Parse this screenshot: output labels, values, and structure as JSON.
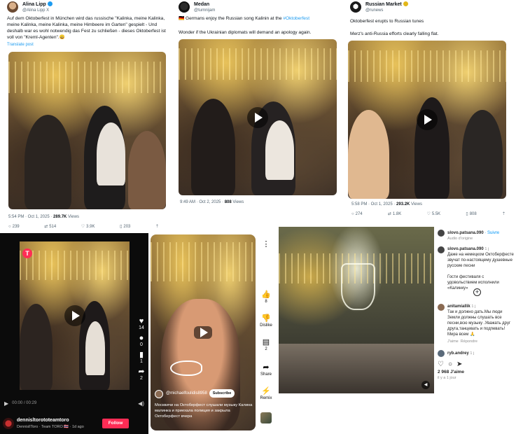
{
  "tweet1": {
    "name": "Alina Lipp",
    "handle": "@Alina Lipp X",
    "text": "Auf dem Oktoberfest in München wird das russische \"Kalinka, meine Kalinka, meine Kalinka, meine Kalinka, meine Himbeere im Garten\" gespielt - Und deshalb war es wohl notwendig das Fest zu schließen - dieses Oktoberfest ist voll von \"Kreml-Agenten\".😀",
    "translate": "Translate post",
    "time": "5:54 PM · Oct 1, 2025 · ",
    "views": "289.7K",
    "views_label": " Views",
    "replies": "239",
    "retweets": "514",
    "likes": "3.9K",
    "bookmarks": "203"
  },
  "tweet2": {
    "name": "Medan",
    "handle": "@tumnijam",
    "text_flag": "🇩🇪",
    "text_a": " Germans enjoy the Russian song Kalinin at the ",
    "hashtag": "#Oktoberfest",
    "text_b": "Wonder if the Ukrainian diplomats will demand an apology again.",
    "time": "9:49 AM · Oct 2, 2025 · ",
    "views": "808",
    "views_label": " Views"
  },
  "tweet3": {
    "name": "Russian Market",
    "handle": "@runews",
    "text_a": "Oktoberfest erupts to Russian tunes",
    "text_b": "Merz's anti-Russia efforts clearly falling flat.",
    "time": "5:58 PM · Oct 1, 2025 · ",
    "views": "293.2K",
    "views_label": " Views",
    "replies": "274",
    "retweets": "1.8K",
    "likes": "5.5K",
    "bookmarks": "808"
  },
  "tiktok": {
    "username": "dennisltorototeamtoro",
    "subline": "DennisllToro · Team TORO 🇹🇭 · 1d ago",
    "follow": "Follow",
    "time": "00:00 / 00:29",
    "likes": "14",
    "comments": "0",
    "bookmarks": "1",
    "shares": "2",
    "logo_letter": "T"
  },
  "shorts": {
    "channel": "@michaelfoulidis8958",
    "subscribe": "Subscribe",
    "caption": "Москвичи на Октоберфест слушали музыку Калина малинка и приехала полиция и закрыла Октоберфест вчера",
    "likes": "8",
    "dislike": "Dislike",
    "comments": "2",
    "share": "Share",
    "remix": "Remix"
  },
  "instagram": {
    "user": "slovo.patsana.090",
    "follow": "· Suivre",
    "audio": "Audio d'origine",
    "caption_user": "slovo.patsana.090",
    "caption_ago": "1 j",
    "caption": "Даже на немецком Октоберфесте звучат по-настоящему душевные русские песни",
    "caption2": "Гости фестиваля с удовольствием исполнили «Калинку»",
    "c1_user": "anitamiallik",
    "c1_ago": "1 j",
    "c1_text": "Так и должно дать.Мы люди Земли должны слушать все песни,всю музыку .Уважать друг друга,танцевать и подпевать! Мира всем 🙏",
    "c1_like": "J'aime",
    "c1_reply": "Répondre",
    "c2_user": "ryb.andrey",
    "c2_ago": "1 j",
    "likes": "2 968 J'aime",
    "date": "il y a 1 jour"
  }
}
